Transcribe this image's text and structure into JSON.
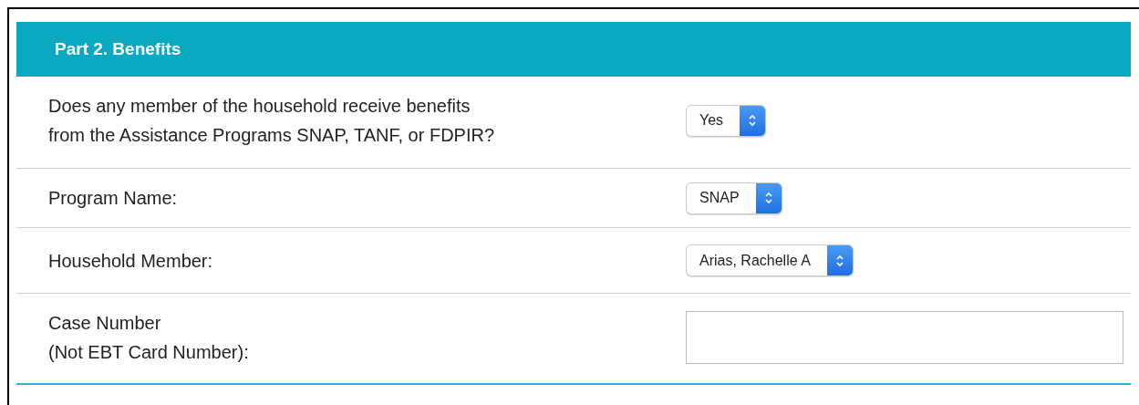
{
  "section": {
    "title": "Part 2. Benefits"
  },
  "fields": [
    {
      "kind": "select",
      "label": [
        "Does any member of the household receive benefits",
        "from the Assistance Programs SNAP, TANF, or FDPIR?"
      ],
      "value": "Yes"
    },
    {
      "kind": "select",
      "label": [
        "Program Name:"
      ],
      "value": "SNAP"
    },
    {
      "kind": "select",
      "label": [
        "Household Member:"
      ],
      "value": "Arias, Rachelle A"
    },
    {
      "kind": "text",
      "label": [
        "Case Number",
        "(Not EBT Card Number):"
      ]
    }
  ]
}
